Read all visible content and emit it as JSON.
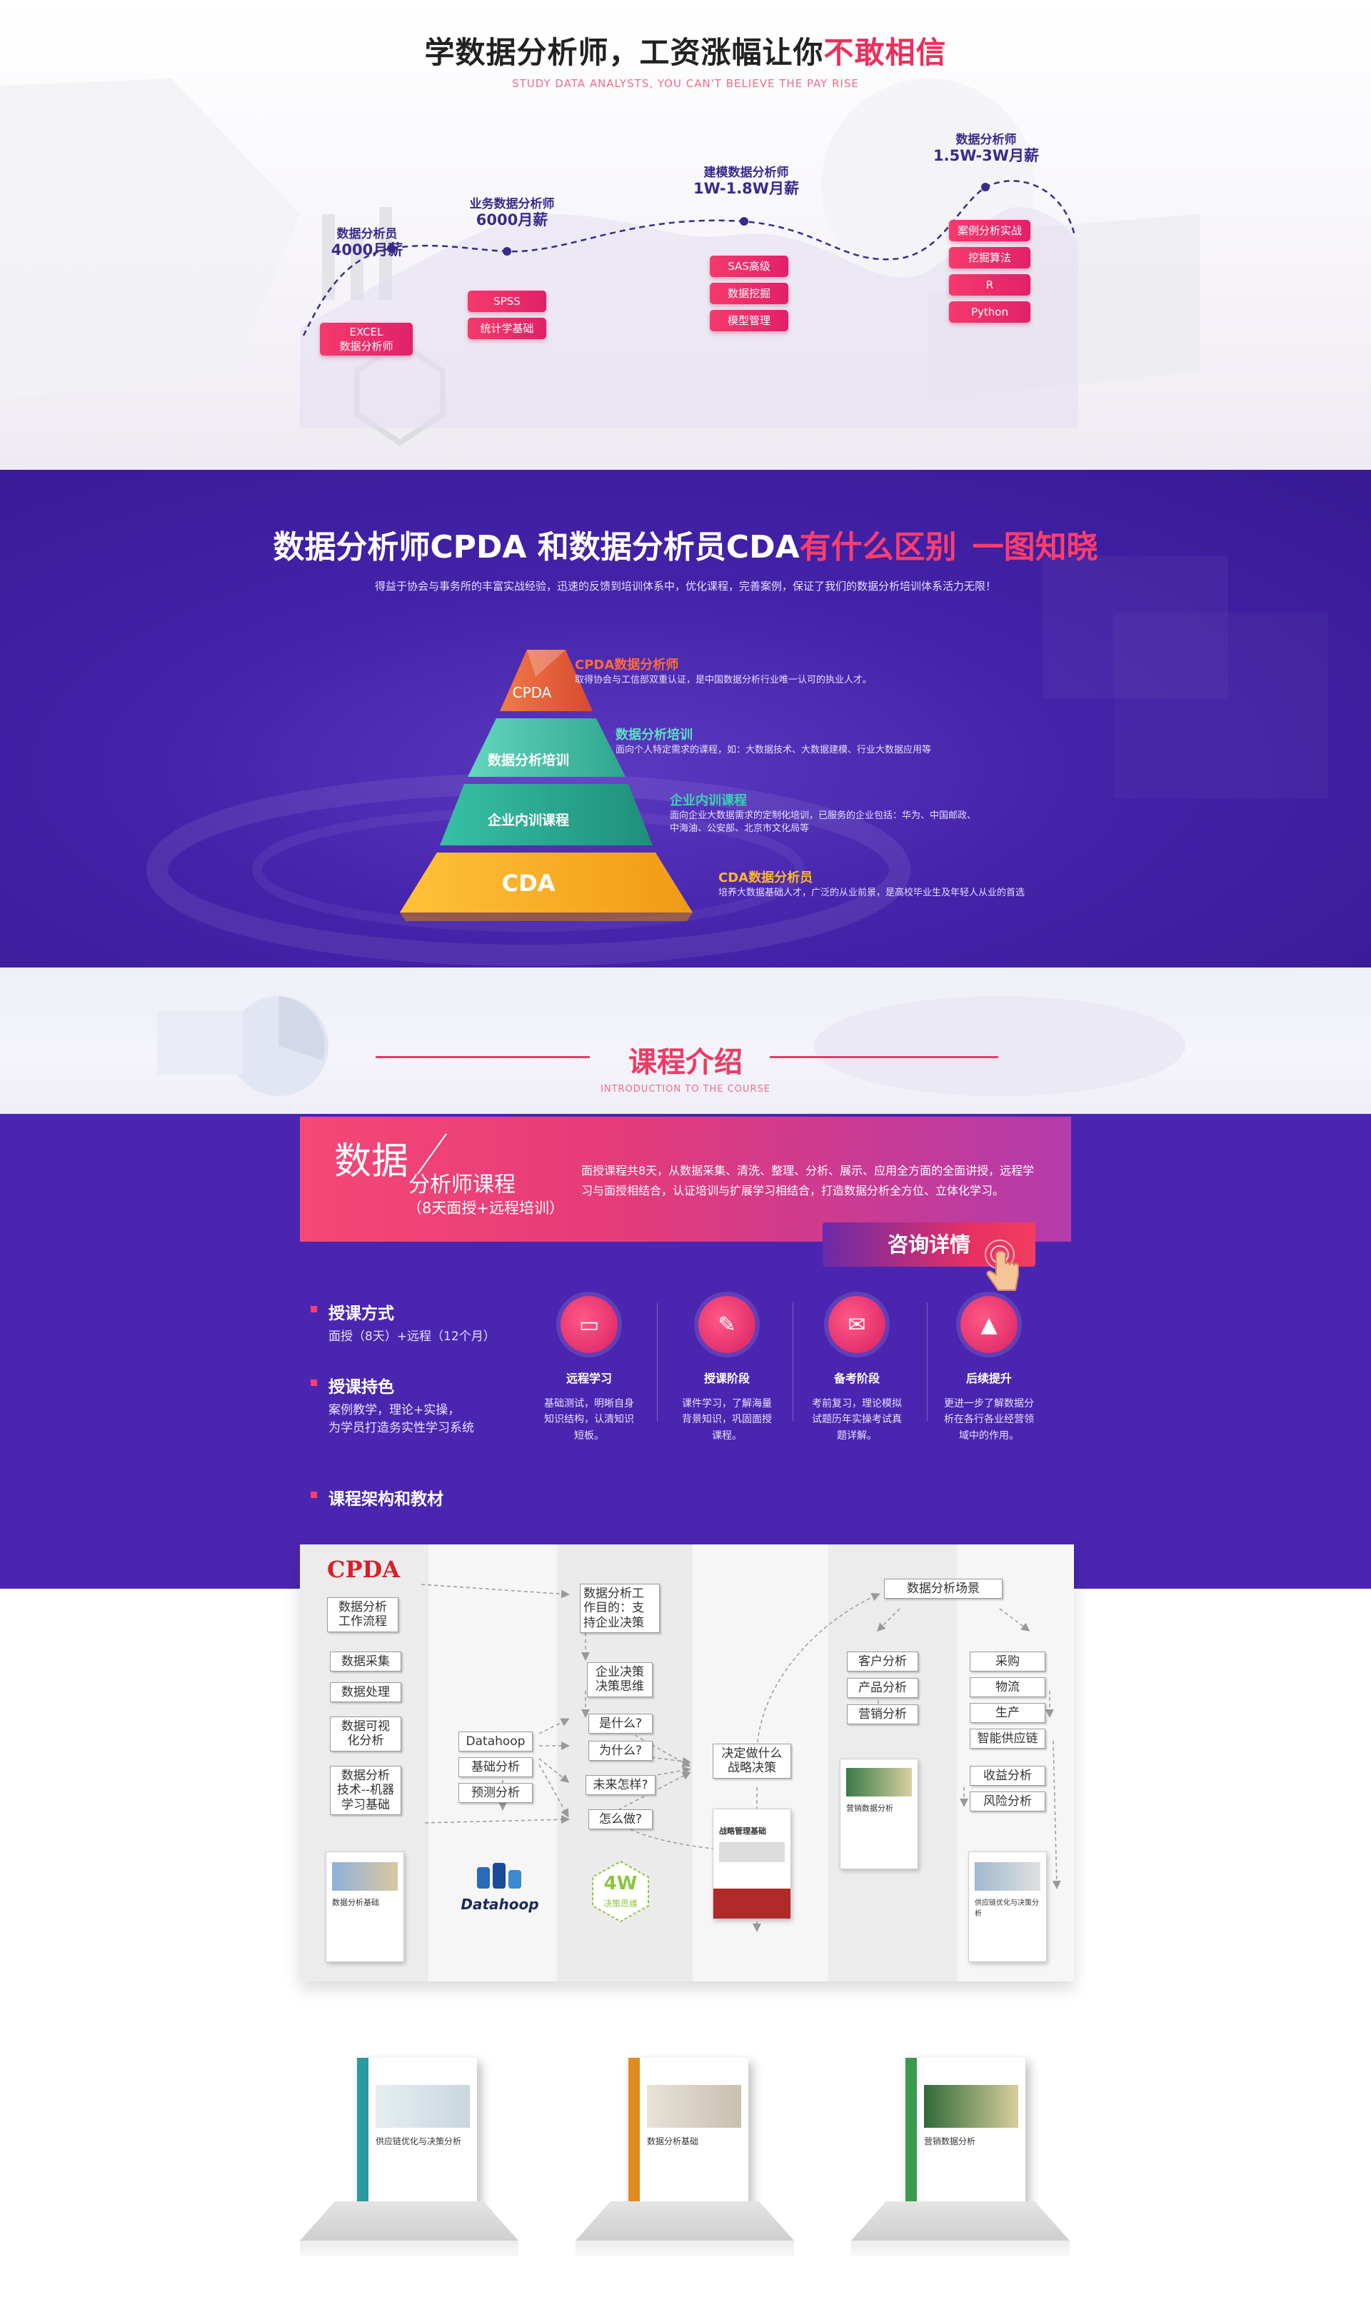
{
  "salary": {
    "title_main": "学数据分析师，工资涨幅让你",
    "title_hl": "不敢相信",
    "subtitle": "STUDY DATA ANALYSTS, YOU CAN'T BELIEVE THE PAY RISE",
    "stages": [
      {
        "title": "数据分析员",
        "salary": "4000月薪",
        "tags": [
          "EXCEL\n数据分析师"
        ]
      },
      {
        "title": "业务数据分析师",
        "salary": "6000月薪",
        "tags": [
          "SPSS",
          "统计学基础"
        ]
      },
      {
        "title": "建模数据分析师",
        "salary": "1W-1.8W月薪",
        "tags": [
          "SAS高级",
          "数据挖掘",
          "模型管理"
        ]
      },
      {
        "title": "数据分析师",
        "salary": "1.5W-3W月薪",
        "tags": [
          "案例分析实战",
          "挖掘算法",
          "R",
          "Python"
        ]
      }
    ]
  },
  "compare": {
    "title_main": "数据分析师CPDA 和数据分析员CDA",
    "title_hl": "有什么区别",
    "title_tail": "一图知晓",
    "subtitle": "得益于协会与事务所的丰富实战经验，迅速的反馈到培训体系中，优化课程，完善案例，保证了我们的数据分析培训体系活力无限！",
    "levels": [
      {
        "label": "CPDA",
        "name": "CPDA数据分析师",
        "desc": "取得协会与工信部双重认证，是中国数据分析行业唯一认可的执业人才。",
        "color": "#e7603d"
      },
      {
        "label": "数据分析培训",
        "name": "数据分析培训",
        "desc": "面向个人特定需求的课程，如：大数据技术、大数据建模、行业大数据应用等",
        "color": "#4fc7b0"
      },
      {
        "label": "企业内训课程",
        "name": "企业内训课程",
        "desc": "面向企业大数据需求的定制化培训，已服务的企业包括：华为、中国邮政、",
        "desc2": "中海油、公安部、北京市文化局等",
        "color": "#2fc3a8"
      },
      {
        "label": "CDA",
        "name": "CDA数据分析员",
        "desc": "培养大数据基础人才，广泛的从业前景，是高校毕业生及年轻人从业的首选",
        "color": "#ffb72a"
      }
    ]
  },
  "course": {
    "title": "课程介绍",
    "subtitle": "INTRODUCTION TO THE COURSE",
    "banner_big": "数据",
    "banner_mid": "分析师课程",
    "banner_small": "（8天面授+远程培训）",
    "banner_desc": "面授课程共8天，从数据采集、清洗、整理、分析、展示、应用全方面的全面讲授，远程学习与面授相结合，认证培训与扩展学习相结合，打造数据分析全方位、立体化学习。",
    "method_title": "授课方式",
    "method_text": "面授（8天）+远程（12个月）",
    "feature_title": "授课持色",
    "feature_text1": "案例教学，理论+实操，",
    "feature_text2": "为学员打造务实性学习系统",
    "arch_title": "课程架构和教材",
    "consult": "咨询详情",
    "features": [
      {
        "name": "远程学习",
        "desc": "基础测试，明晰自身\n知识结构，认清知识\n短板。"
      },
      {
        "name": "授课阶段",
        "desc": "课件学习，了解海量\n背景知识，巩固面授\n课程。"
      },
      {
        "name": "备考阶段",
        "desc": "考前复习，理论模拟\n试题历年实操考试真\n题详解。"
      },
      {
        "name": "后续提升",
        "desc": "更进一步了解数据分\n析在各行各业经营领\n域中的作用。"
      }
    ]
  },
  "diagram": {
    "logo": "CPDA",
    "workflow": "数据分析\n工作流程",
    "left_items": [
      "数据采集",
      "数据处理",
      "数据可视\n化分析",
      "数据分析\n技术--机器\n学习基础"
    ],
    "tools": [
      "Datahoop",
      "基础分析",
      "预测分析"
    ],
    "purpose": "数据分析工\n作目的：支\n持企业决策",
    "decision": "企业决策\n决策思维",
    "questions": [
      "是什么?",
      "为什么?",
      "未来怎样?",
      "怎么做?"
    ],
    "strategy": "决定做什么\n战略决策",
    "scene": "数据分析场景",
    "mid_items": [
      "客户分析",
      "产品分析",
      "营销分析"
    ],
    "right_items": [
      "采购",
      "物流",
      "生产",
      "智能供应链"
    ],
    "right_items2": [
      "收益分析",
      "风险分析"
    ],
    "datahoop_logo": "Datahoop",
    "fourw": "4W",
    "fourw_sub": "决策思维",
    "book_titles": [
      "数据分析基础",
      "战略管理基础",
      "营销数据分析",
      "供应链优化与决策分析"
    ]
  },
  "books": {
    "titles": [
      "供应链优化与决策分析",
      "数据分析基础",
      "营销数据分析"
    ],
    "colors": [
      "#2a9aa0",
      "#e08a20",
      "#3a9a50"
    ]
  }
}
